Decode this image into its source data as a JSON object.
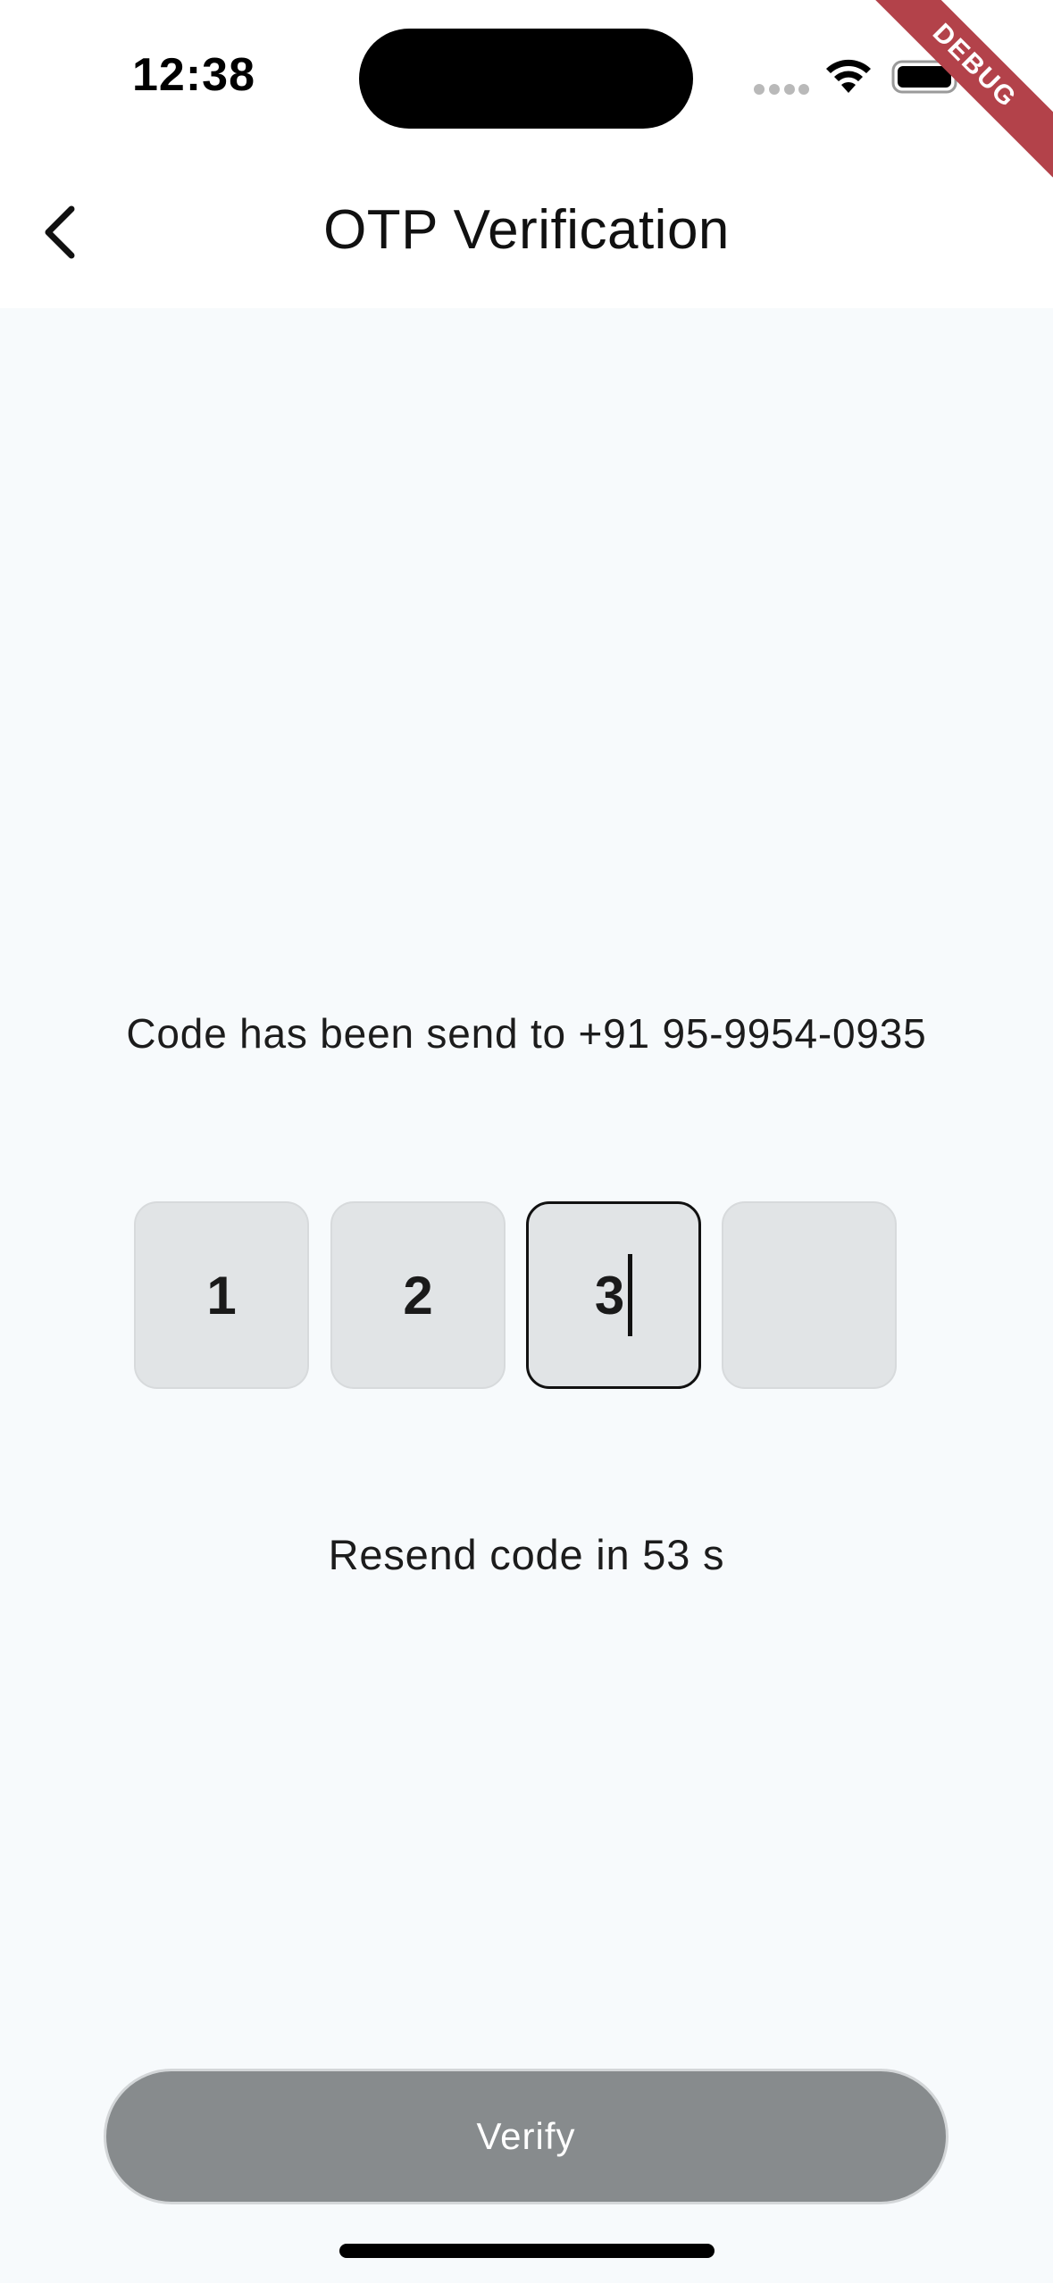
{
  "status_bar": {
    "time": "12:38",
    "icons": [
      "signal-dots-icon",
      "wifi-icon",
      "battery-icon"
    ]
  },
  "debug_banner": "DEBUG",
  "app_bar": {
    "back_icon": "chevron-left-icon",
    "title": "OTP Verification"
  },
  "message": "Code has been send to +91 95-9954-0935",
  "otp": {
    "digits": [
      "1",
      "2",
      "3",
      ""
    ],
    "active_index": 2
  },
  "resend": "Resend code in 53 s",
  "verify_label": "Verify",
  "colors": {
    "background": "#f7fafc",
    "otp_box": "#e1e4e6",
    "verify_button_disabled": "#878b8d",
    "debug_banner": "#b3424a"
  }
}
